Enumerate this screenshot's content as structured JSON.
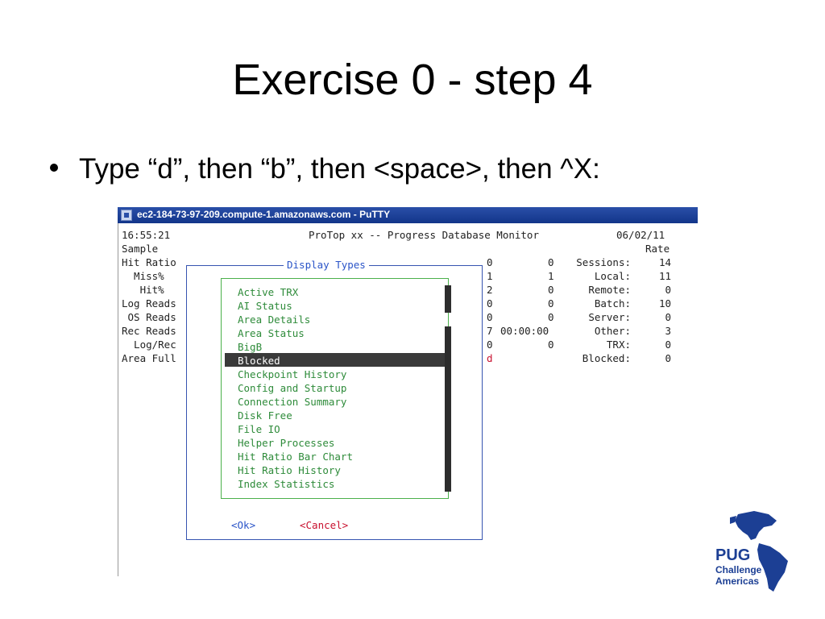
{
  "slide": {
    "title": "Exercise 0  -  step 4",
    "bullet": "Type “d”, then “b”, then <space>, then ^X:"
  },
  "window": {
    "title": "ec2-184-73-97-209.compute-1.amazonaws.com - PuTTY"
  },
  "terminal": {
    "time": "16:55:21",
    "header": "ProTop xx -- Progress Database Monitor",
    "date": "06/02/11",
    "rate_label": "Rate",
    "left_labels": [
      "Sample",
      "Hit Ratio",
      "  Miss%",
      "   Hit%",
      "Log Reads",
      " OS Reads",
      "Rec Reads",
      "  Log/Rec",
      "Area Full"
    ],
    "mid_col1": [
      "0",
      "1",
      "2",
      "0",
      "0",
      "7",
      "0"
    ],
    "mid_col2": [
      "0",
      "1",
      "0",
      "0",
      "0",
      "00:00:00",
      "0"
    ],
    "stray_char": "d",
    "right_labels": [
      "Sessions:",
      "Local:",
      "Remote:",
      "Batch:",
      "Server:",
      "Other:",
      "TRX:",
      "Blocked:"
    ],
    "right_values": [
      "14",
      "11",
      "0",
      "10",
      "0",
      "3",
      "0",
      "0"
    ]
  },
  "dialog": {
    "title": "Display Types",
    "items": [
      "Active TRX",
      "AI Status",
      "Area Details",
      "Area Status",
      "BigB",
      "Blocked",
      "Checkpoint History",
      "Config and Startup",
      "Connection Summary",
      "Disk Free",
      "File IO",
      "Helper Processes",
      "Hit Ratio Bar Chart",
      "Hit Ratio History",
      "Index Statistics"
    ],
    "selected_index": 5,
    "ok_label": "<Ok>",
    "cancel_label": "<Cancel>"
  },
  "logo": {
    "line1": "PUG",
    "line2": "Challenge",
    "line3": "Americas"
  },
  "colors": {
    "menu_text": "#2e8b3a",
    "dialog_border": "#3654b0",
    "list_border": "#4bb04b",
    "highlight_bg": "#3a3a3a",
    "cancel": "#c8102e",
    "ok": "#2a54c8"
  }
}
